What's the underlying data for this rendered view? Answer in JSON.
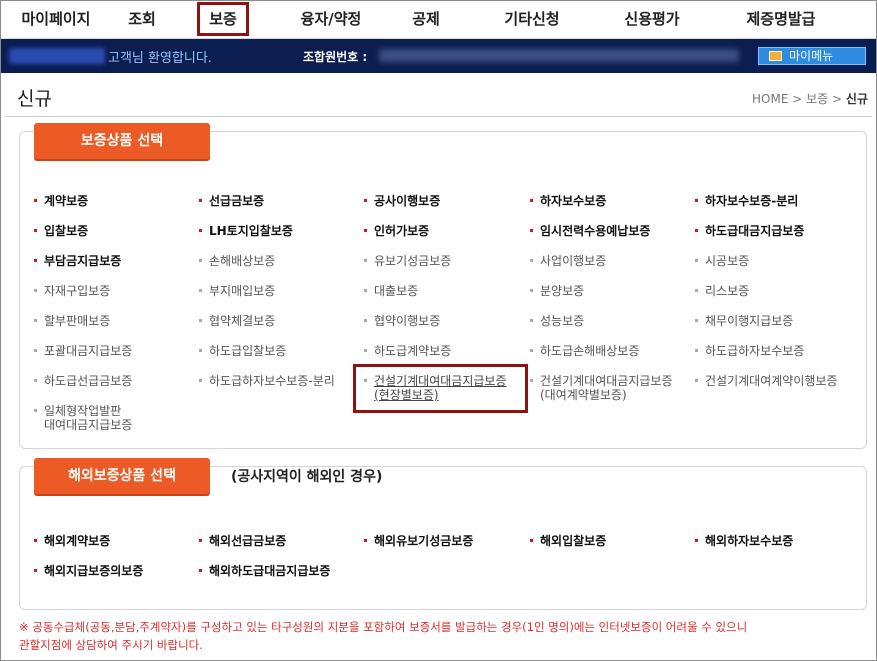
{
  "nav": {
    "items": [
      "마이페이지",
      "조회",
      "보증",
      "융자/약정",
      "공제",
      "기타신청",
      "신용평가",
      "제증명발급"
    ]
  },
  "welcome": {
    "greeting": "고객님 환영합니다.",
    "member_label": "조합원번호 :",
    "mymenu_label": "마이메뉴"
  },
  "page": {
    "title": "신규",
    "breadcrumb": {
      "home": "HOME",
      "sep1": " > ",
      "mid": "보증",
      "sep2": " > ",
      "current": "신규"
    }
  },
  "section1": {
    "tab": "보증상품 선택",
    "items": [
      "계약보증",
      "선급금보증",
      "공사이행보증",
      "하자보수보증",
      "하자보수보증-분리",
      "입찰보증",
      "LH토지입찰보증",
      "인허가보증",
      "임시전력수용예납보증",
      "하도급대금지급보증",
      "부담금지급보증",
      "손해배상보증",
      "유보기성금보증",
      "사업이행보증",
      "시공보증",
      "자재구입보증",
      "부지매입보증",
      "대출보증",
      "분양보증",
      "리스보증",
      "할부판매보증",
      "협약체결보증",
      "협약이행보증",
      "성능보증",
      "채무이행지급보증",
      "포괄대금지급보증",
      "하도급입찰보증",
      "하도급계약보증",
      "하도급손해배상보증",
      "하도급하자보수보증",
      "하도급선급금보증",
      "하도급하자보수보증-분리"
    ],
    "two_line": [
      {
        "l1": "건설기계대여대금지급보증",
        "l2": "(현장별보증)"
      },
      {
        "l1": "건설기계대여대금지급보증",
        "l2": "(대여계약별보증)"
      },
      {
        "l1": "일체형작업발판",
        "l2": "대여대금지급보증"
      }
    ],
    "last_row_item": "건설기계대여계약이행보증"
  },
  "section2": {
    "tab": "해외보증상품 선택",
    "note": "(공사지역이 해외인 경우)",
    "items": [
      "해외계약보증",
      "해외선급금보증",
      "해외유보기성금보증",
      "해외입찰보증",
      "해외하자보수보증",
      "해외지급보증의보증",
      "해외하도급대금지급보증"
    ]
  },
  "notice": {
    "line1": "※ 공동수급체(공동,분담,주계약자)를 구성하고 있는 타구성원의 지분을 포함하여 보증서를 발급하는 경우(1인 명의)에는 인터넷보증이 어려울 수 있으니",
    "line2": "관할지점에 상담하여 주시기 바랍니다."
  },
  "colors": {
    "accent": "#ec5a25",
    "navy": "#0b1e52",
    "highlight": "#8e1313",
    "bullet_bold": "#d0162c"
  }
}
